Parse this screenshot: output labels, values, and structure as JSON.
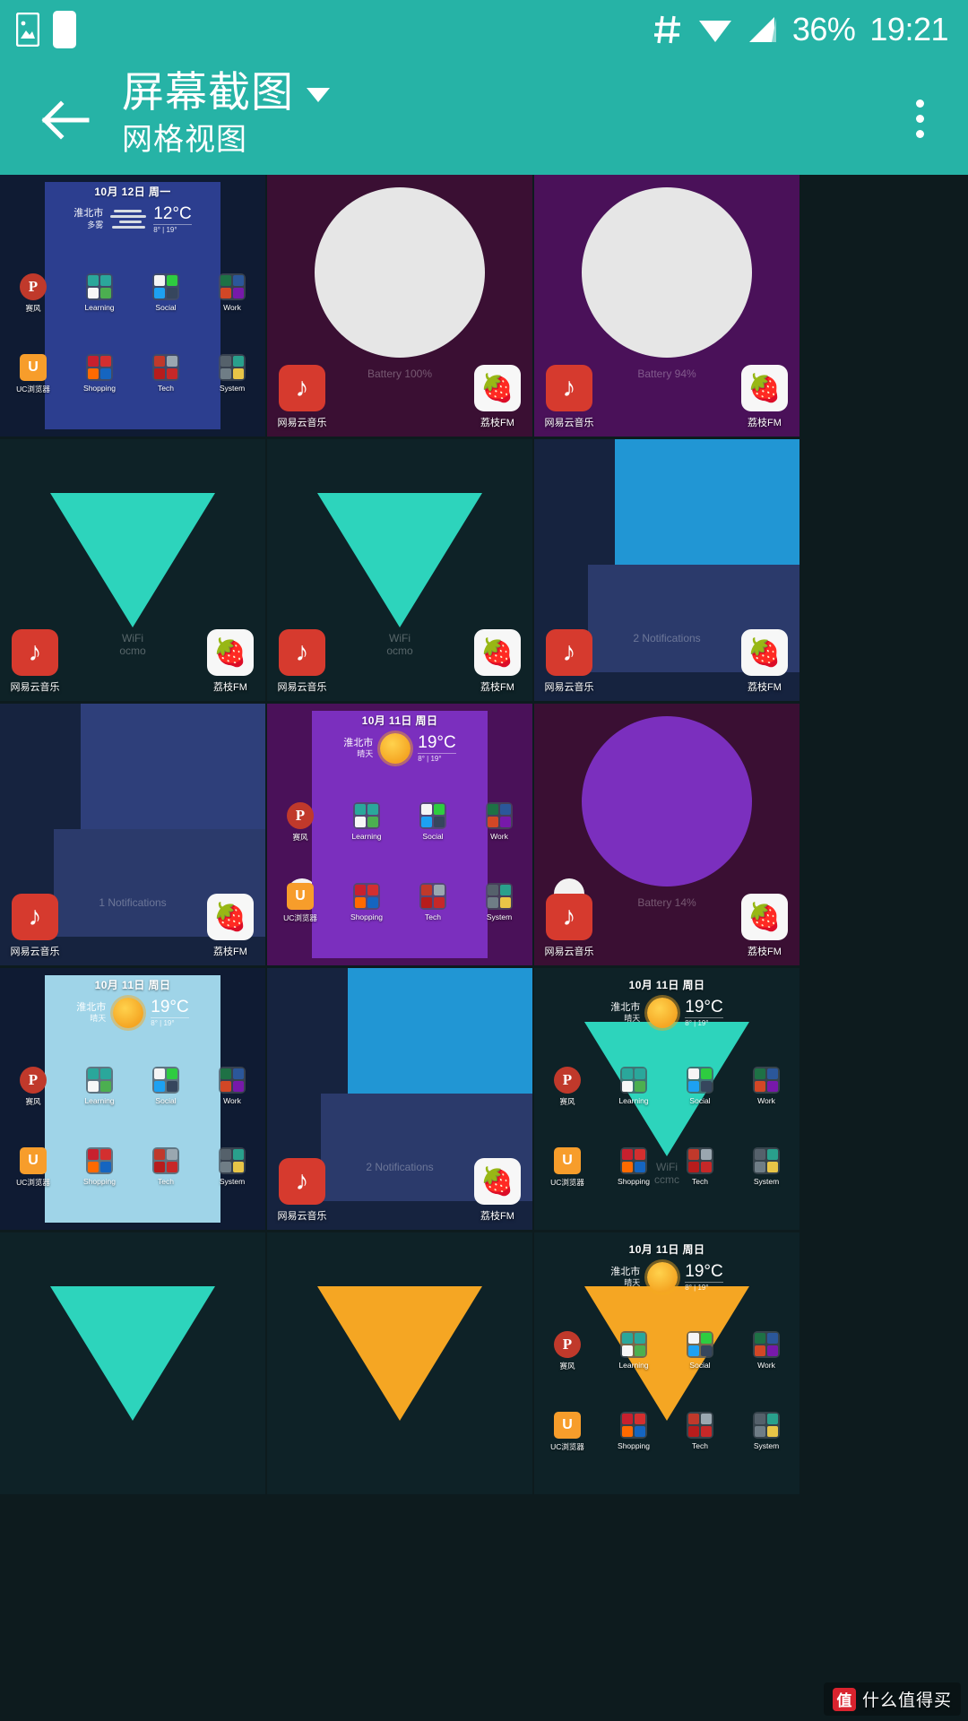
{
  "statusbar": {
    "icons": [
      "image-icon",
      "blank-card-icon",
      "hash-icon",
      "wifi-icon",
      "signal-icon"
    ],
    "battery_percent": "36%",
    "clock": "19:21"
  },
  "appbar": {
    "back_icon": "back-arrow-icon",
    "title": "屏幕截图",
    "subtitle": "网格视图",
    "caret_icon": "chevron-down-icon",
    "overflow_icon": "more-vertical-icon"
  },
  "colors": {
    "accent": "#26b3a6",
    "teal_shape": "#2dd4bc",
    "orange_shape": "#f5a623",
    "blue_shape": "#2196d4",
    "purple_shape": "#7b2fbe",
    "dark_purple_bg": "#3a0f33",
    "dark_teal_bg": "#0e2227",
    "navy_bg": "#0f1b33",
    "netease_red": "#d63a2e"
  },
  "labels": {
    "netease": "网易云音乐",
    "lizhi": "荔枝FM",
    "uc": "UC浏览器",
    "saifeng": "赛风",
    "learning": "Learning",
    "social": "Social",
    "work": "Work",
    "shopping": "Shopping",
    "tech": "Tech",
    "system": "System"
  },
  "weather_mon": {
    "date": "10月 12日 周一",
    "city": "淮北市",
    "cond": "多雾",
    "temp": "12°C",
    "range": "8° | 19°",
    "icon": "fog-icon"
  },
  "weather_sun": {
    "date": "10月 11日 周日",
    "city": "淮北市",
    "cond": "晴天",
    "temp": "19°C",
    "range": "8° | 19°",
    "icon": "sun-icon"
  },
  "tiles": [
    {
      "id": 1,
      "kind": "home",
      "bg": "#0f1b33",
      "panel": "#2c3e8f",
      "weather": "weather_mon",
      "overlay": ""
    },
    {
      "id": 2,
      "kind": "shape",
      "bg": "#3a0f33",
      "shape": "circle",
      "color": "#e6e6e6",
      "overlay": "Battery 100%",
      "apps": "both"
    },
    {
      "id": 3,
      "kind": "shape",
      "bg": "#4a1159",
      "shape": "circle",
      "color": "#e6e6e6",
      "overlay": "Battery 94%",
      "apps": "both"
    },
    {
      "id": 4,
      "kind": "shape",
      "bg": "#0e2227",
      "shape": "triangle",
      "color": "#2dd4bc",
      "overlay": "WiFi\nocmo",
      "apps": "both"
    },
    {
      "id": 5,
      "kind": "shape",
      "bg": "#0e2227",
      "shape": "triangle",
      "color": "#2dd4bc",
      "overlay": "WiFi\nocmo",
      "apps": "both"
    },
    {
      "id": 6,
      "kind": "shape",
      "bg": "#16233f",
      "shape": "rect",
      "color": "#2196d4",
      "overlay": "2 Notifications",
      "apps": "both"
    },
    {
      "id": 7,
      "kind": "shape",
      "bg": "#16233f",
      "shape": "rect",
      "color": "#2e3f7a",
      "overlay": "1 Notifications",
      "apps": "both"
    },
    {
      "id": 8,
      "kind": "home",
      "bg": "#4a1159",
      "panel": "#7b2fbe",
      "weather": "weather_sun",
      "overlay": "",
      "dot": true
    },
    {
      "id": 9,
      "kind": "shape",
      "bg": "#3a0f33",
      "shape": "circle",
      "color": "#7b2fbe",
      "overlay": "Battery 14%",
      "apps": "both",
      "dot": true
    },
    {
      "id": 10,
      "kind": "home",
      "bg": "#0f1b33",
      "panel": "#9fd4e8",
      "weather": "weather_sun",
      "overlay": ""
    },
    {
      "id": 11,
      "kind": "shape",
      "bg": "#16233f",
      "shape": "rect",
      "color": "#2196d4",
      "overlay": "2 Notifications",
      "apps": "both"
    },
    {
      "id": 12,
      "kind": "home",
      "bg": "#0e2227",
      "panel": "none",
      "weather": "weather_sun",
      "overlay": "WiFi\nccmc",
      "shape": "triangle",
      "color": "#2dd4bc"
    },
    {
      "id": 13,
      "kind": "shape",
      "bg": "#0e2227",
      "shape": "triangle",
      "color": "#2dd4bc",
      "overlay": "",
      "apps": "none"
    },
    {
      "id": 14,
      "kind": "shape",
      "bg": "#0e2227",
      "shape": "triangle",
      "color": "#f5a623",
      "overlay": "",
      "apps": "none"
    },
    {
      "id": 15,
      "kind": "home",
      "bg": "#0e2227",
      "panel": "none",
      "weather": "weather_sun",
      "overlay": "",
      "shape": "triangle",
      "color": "#f5a623"
    }
  ],
  "watermark": {
    "logo": "值",
    "text": "什么值得买"
  }
}
